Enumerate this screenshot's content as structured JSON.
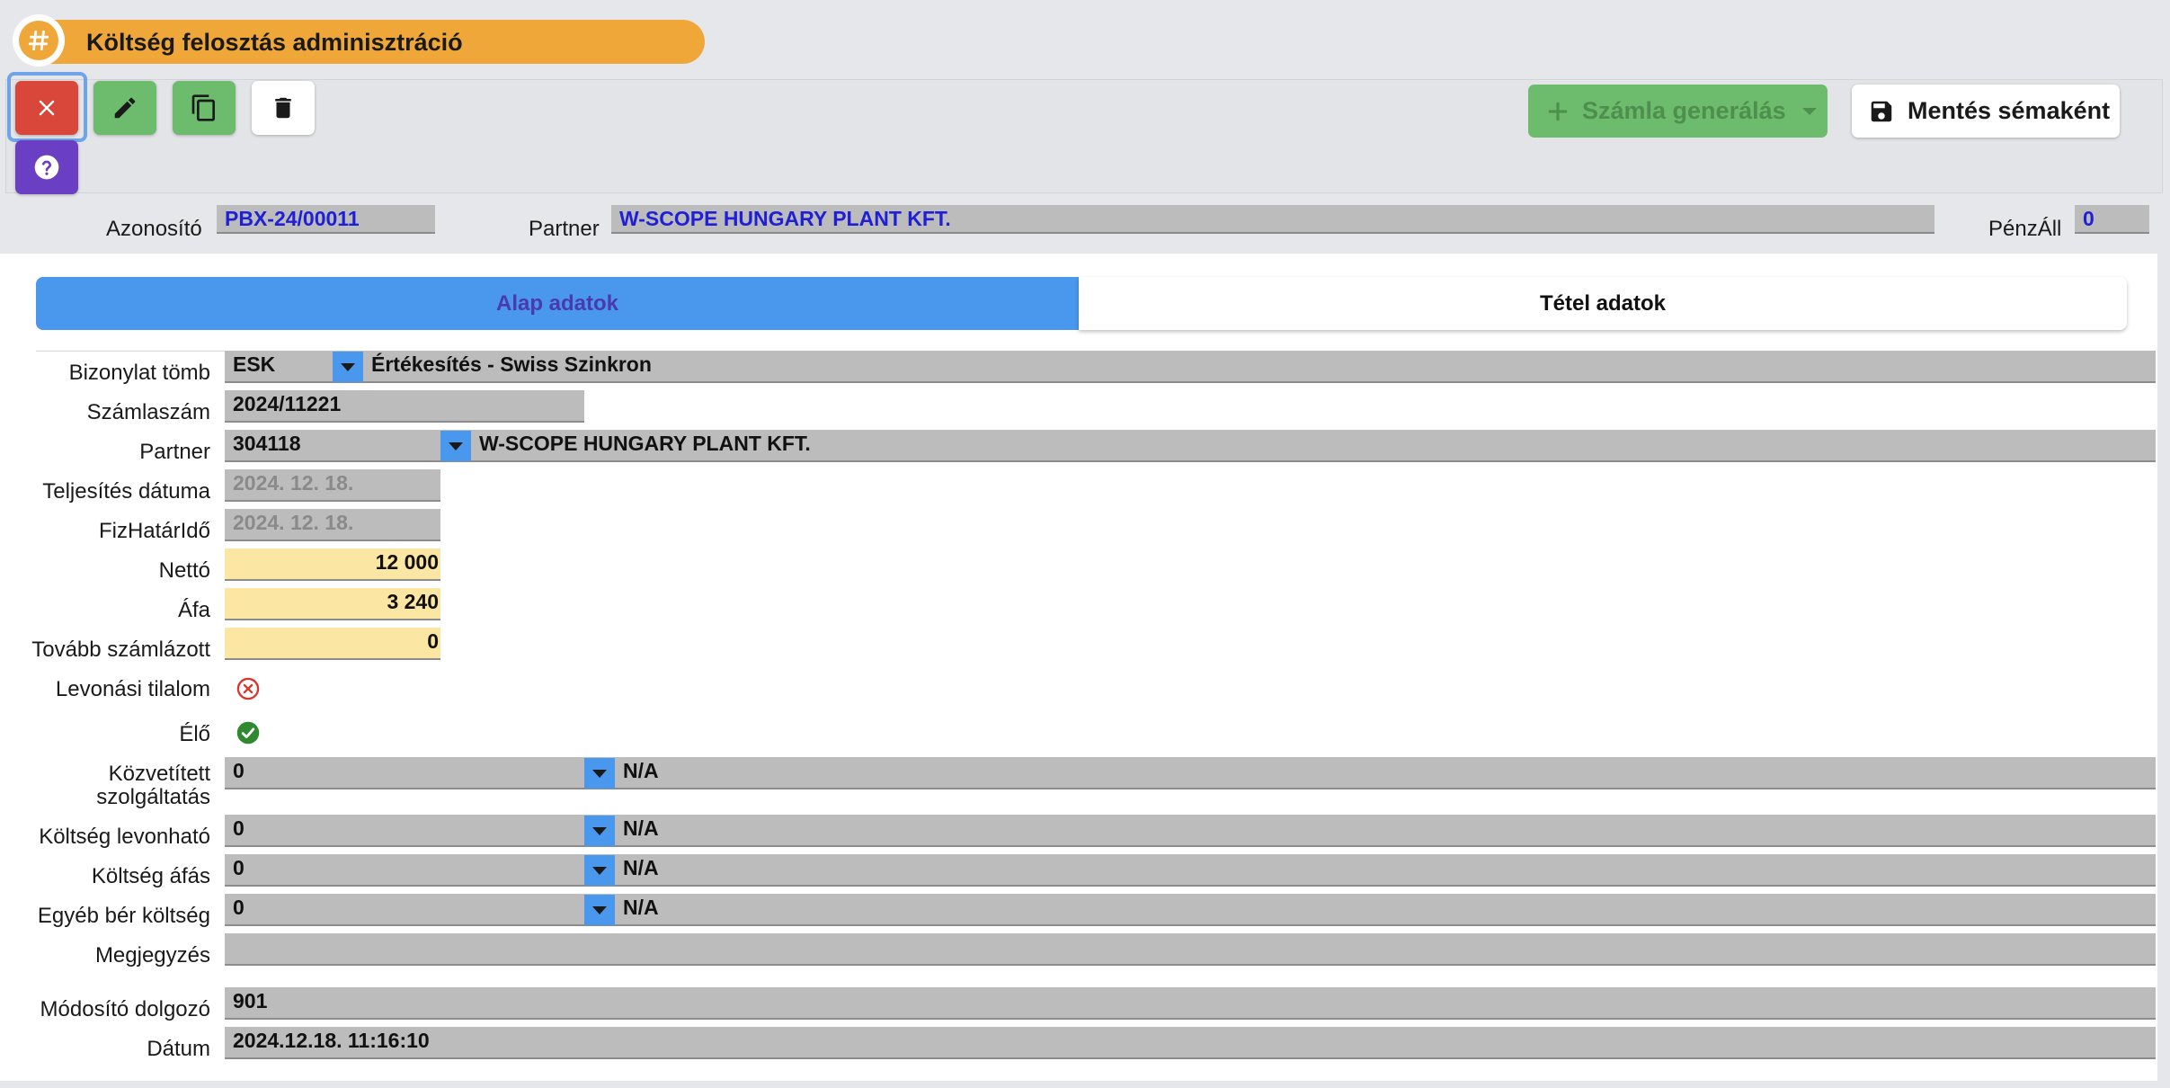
{
  "header": {
    "title": "Költség felosztás adminisztráció",
    "icon": "hash-icon"
  },
  "toolbar": {
    "close_icon": "close-icon",
    "edit_icon": "pencil-icon",
    "copy_icon": "copy-icon",
    "delete_icon": "trash-icon",
    "help_icon": "help-icon",
    "generate_label": "Számla generálás",
    "save_schema_label": "Mentés sémaként"
  },
  "info": {
    "id_label": "Azonosító",
    "id_value": "PBX-24/00011",
    "partner_label": "Partner",
    "partner_value": "W-SCOPE HUNGARY PLANT KFT.",
    "penzall_label": "PénzÁll",
    "penzall_value": "0"
  },
  "tabs": {
    "basic": "Alap adatok",
    "items": "Tétel adatok"
  },
  "form": {
    "bizonylat_label": "Bizonylat tömb",
    "bizonylat_code": "ESK",
    "bizonylat_name": "Értékesítés - Swiss Szinkron",
    "szamlaszam_label": "Számlaszám",
    "szamlaszam_value": "2024/11221",
    "partner_label": "Partner",
    "partner_code": "304118",
    "partner_name": "W-SCOPE HUNGARY PLANT KFT.",
    "teljesites_label": "Teljesítés dátuma",
    "teljesites_value": "2024. 12. 18.",
    "fizhatarido_label": "FizHatárIdő",
    "fizhatarido_value": "2024. 12. 18.",
    "netto_label": "Nettó",
    "netto_value": "12 000",
    "afa_label": "Áfa",
    "afa_value": "3 240",
    "tovabb_label": "Tovább számlázott",
    "tovabb_value": "0",
    "levonasi_label": "Levonási tilalom",
    "elo_label": "Élő",
    "kozvetitett_label_1": "Közvetített",
    "kozvetitett_label_2": "szolgáltatás",
    "kozvetitett_code": "0",
    "kozvetitett_name": "N/A",
    "koltseg_levonhato_label": "Költség levonható",
    "koltseg_levonhato_code": "0",
    "koltseg_levonhato_name": "N/A",
    "koltseg_afas_label": "Költség áfás",
    "koltseg_afas_code": "0",
    "koltseg_afas_name": "N/A",
    "egyeb_label": "Egyéb bér költség",
    "egyeb_code": "0",
    "egyeb_name": "N/A",
    "megjegyzes_label": "Megjegyzés",
    "megjegyzes_value": "",
    "modosito_label": "Módosító dolgozó",
    "modosito_value": "901",
    "datum_label": "Dátum",
    "datum_value": "2024.12.18. 11:16:10"
  },
  "colors": {
    "title_orange": "#f0a73a",
    "close_red": "#d9463a",
    "action_green": "#6dbb6d",
    "help_purple": "#6a3fc4",
    "tab_blue": "#4a97ee",
    "field_gray": "#bcbcbc",
    "field_yellow": "#fbe6a3"
  }
}
